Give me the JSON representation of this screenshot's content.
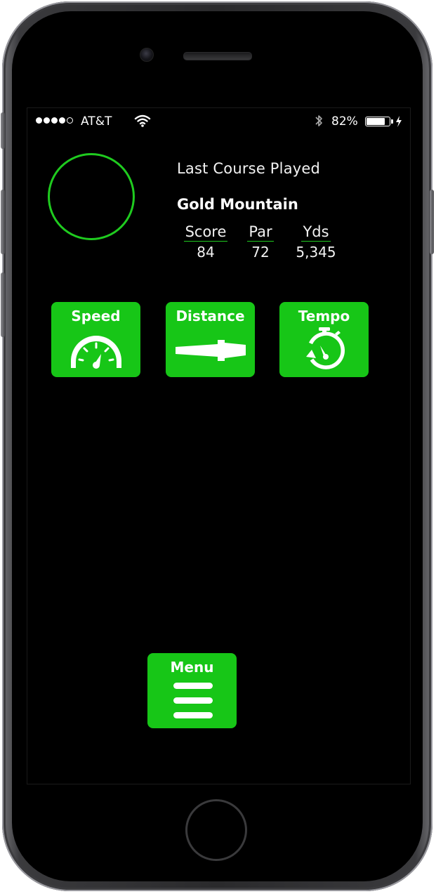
{
  "status_bar": {
    "carrier": "AT&T",
    "signal_bars_filled": 4,
    "signal_bars_total": 5,
    "battery_percent": "82%",
    "battery_level": 0.82,
    "charging": true,
    "bluetooth": true,
    "icons": [
      "wifi-icon",
      "bluetooth-icon",
      "battery-icon",
      "charging-bolt-icon"
    ]
  },
  "last_course": {
    "title": "Last Course Played",
    "course_name": "Gold Mountain",
    "stats": [
      {
        "label": "Score",
        "value": "84"
      },
      {
        "label": "Par",
        "value": "72"
      },
      {
        "label": "Yds",
        "value": "5,345"
      }
    ]
  },
  "tiles": {
    "speed": {
      "label": "Speed",
      "icon": "speedometer-icon"
    },
    "distance": {
      "label": "Distance",
      "icon": "golf-club-icon"
    },
    "tempo": {
      "label": "Tempo",
      "icon": "stopwatch-icon"
    }
  },
  "menu": {
    "label": "Menu",
    "icon": "hamburger-menu-icon"
  },
  "colors": {
    "accent": "#17c617",
    "ring": "#1fcb1f",
    "background": "#000000",
    "text": "#ffffff"
  }
}
